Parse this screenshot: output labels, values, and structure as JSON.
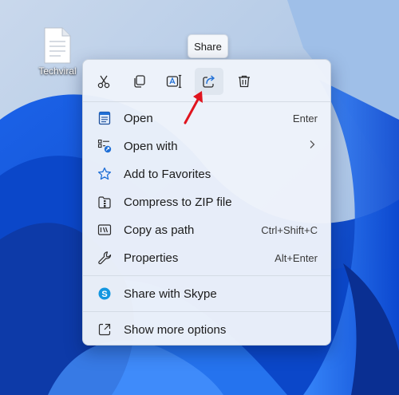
{
  "desktop": {
    "icon_label": "Techviral"
  },
  "tooltip": {
    "text": "Share"
  },
  "toolbar": {
    "buttons": [
      {
        "icon": "cut-icon"
      },
      {
        "icon": "copy-icon"
      },
      {
        "icon": "rename-icon"
      },
      {
        "icon": "share-icon",
        "state": "hover"
      },
      {
        "icon": "delete-icon"
      }
    ]
  },
  "menu": {
    "items": [
      {
        "label": "Open",
        "shortcut": "Enter",
        "icon": "notepad-icon"
      },
      {
        "label": "Open with",
        "shortcut": "",
        "icon": "open-with-icon"
      },
      {
        "label": "Add to Favorites",
        "shortcut": "",
        "icon": "star-icon"
      },
      {
        "label": "Compress to ZIP file",
        "shortcut": "",
        "icon": "zip-icon"
      },
      {
        "label": "Copy as path",
        "shortcut": "Ctrl+Shift+C",
        "icon": "copy-path-icon"
      },
      {
        "label": "Properties",
        "shortcut": "Alt+Enter",
        "icon": "wrench-icon"
      },
      {
        "label": "Share with Skype",
        "shortcut": "",
        "icon": "skype-icon"
      },
      {
        "label": "Show more options",
        "shortcut": "",
        "icon": "more-options-icon"
      }
    ]
  },
  "colors": {
    "accent": "#1f6fd6",
    "wallpaper": "#0a4fd6",
    "arrow": "#e0141e"
  }
}
